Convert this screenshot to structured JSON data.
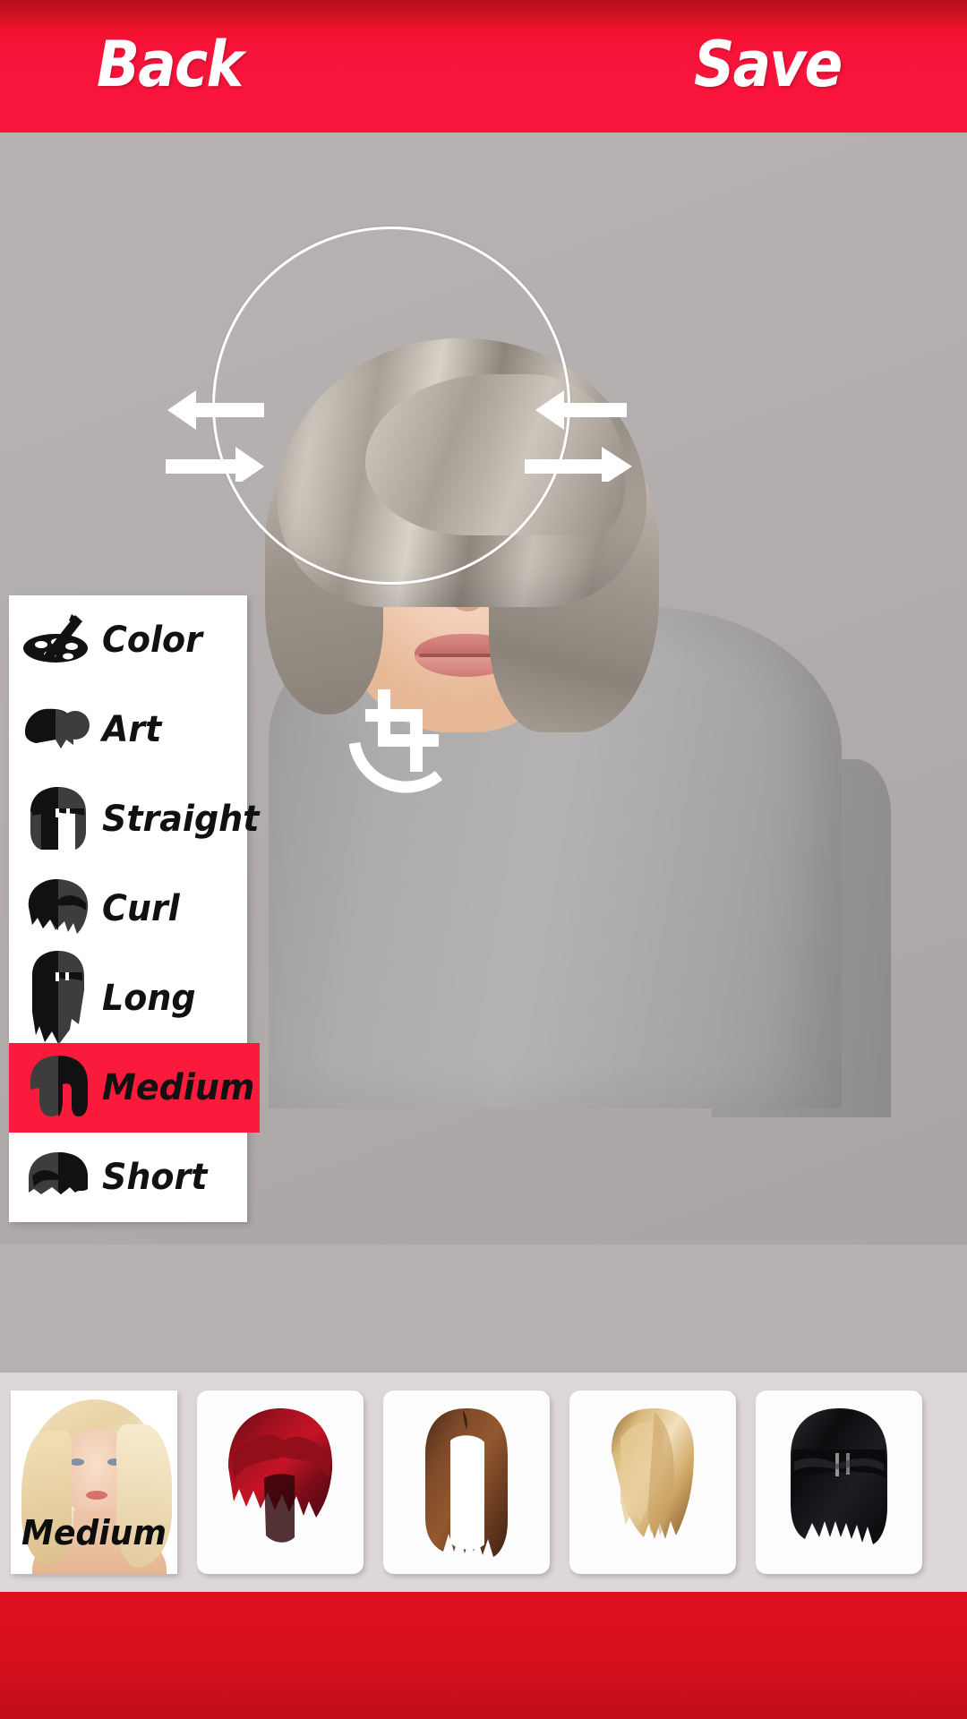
{
  "app": {
    "accent_red": "#fa1a3c",
    "header_red": "#f7143a",
    "footer_red": "#d60f1d",
    "canvas_bg": "#b6b1b1",
    "strip_bg": "#ddd7d7",
    "panel_white": "#ffffff"
  },
  "header": {
    "back_label": "Back",
    "save_label": "Save"
  },
  "canvas": {
    "overlay_circle": "selection-circle",
    "handles": {
      "left_arrows": "scale-left-arrows",
      "right_arrows": "scale-right-arrows",
      "crop_rotate": "crop-rotate-handle"
    }
  },
  "sidebar": {
    "items": [
      {
        "label": "Color",
        "icon": "palette-brush-icon",
        "selected": false
      },
      {
        "label": "Art",
        "icon": "hair-art-icon",
        "selected": false
      },
      {
        "label": "Straight",
        "icon": "hair-straight-icon",
        "selected": false
      },
      {
        "label": "Curl",
        "icon": "hair-curl-icon",
        "selected": false
      },
      {
        "label": "Long",
        "icon": "hair-long-icon",
        "selected": false
      },
      {
        "label": "Medium",
        "icon": "hair-medium-icon",
        "selected": true
      },
      {
        "label": "Short",
        "icon": "hair-short-icon",
        "selected": false
      }
    ],
    "selected_label": "Medium"
  },
  "thumbnails": {
    "category_label": "Medium",
    "items": [
      {
        "name": "category-cover-medium",
        "type": "cover",
        "label": "Medium",
        "color": "#e8d2a5"
      },
      {
        "name": "wig-red-layered-bob",
        "type": "wig",
        "label": "",
        "color": "#8e1120"
      },
      {
        "name": "wig-brown-long-bob",
        "type": "wig",
        "label": "",
        "color": "#7a4a2c"
      },
      {
        "name": "wig-blonde-side-swept",
        "type": "wig",
        "label": "",
        "color": "#d9b271"
      },
      {
        "name": "wig-black-blunt-bangs",
        "type": "wig",
        "label": "",
        "color": "#151515"
      }
    ]
  }
}
